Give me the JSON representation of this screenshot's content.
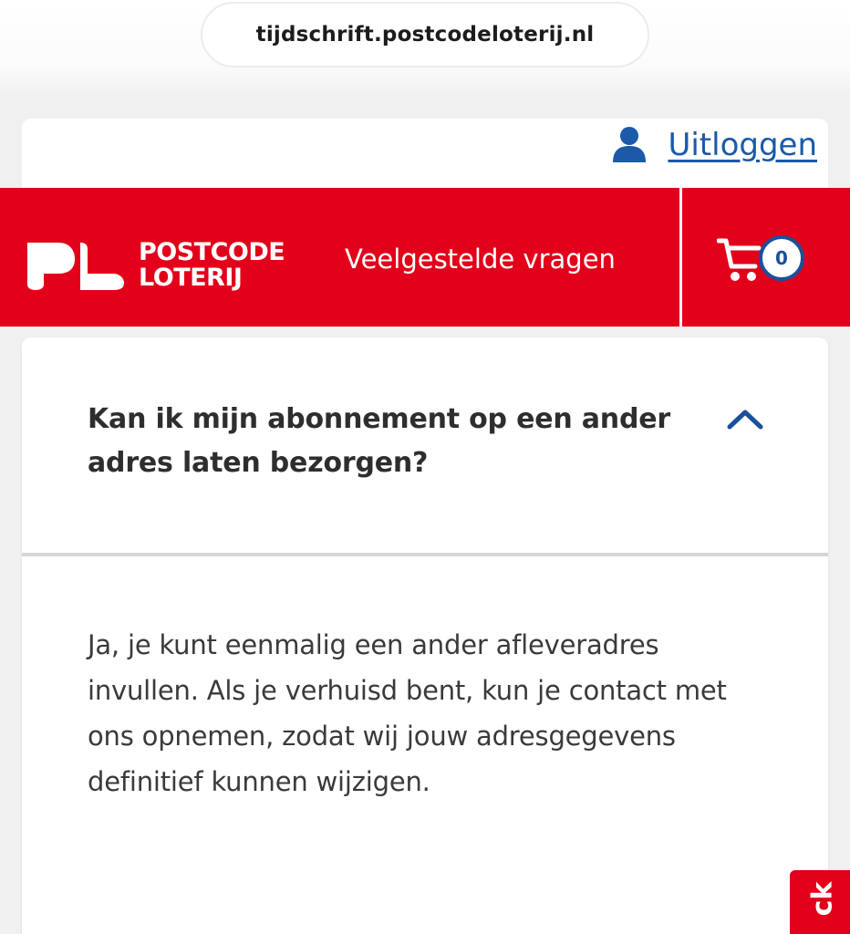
{
  "browser": {
    "url": "tijdschrift.postcodeloterij.nl"
  },
  "account": {
    "logout_label": "Uitloggen",
    "icon": "user-icon"
  },
  "header": {
    "logo_line1": "POSTCODE",
    "logo_line2": "LOTERIJ",
    "page_title": "Veelgestelde vragen",
    "cart_count": "0",
    "brand_color": "#e2001a",
    "accent_color": "#1b4f9c"
  },
  "faq": {
    "question": "Kan ik mijn abonnement op een ander adres laten bezorgen?",
    "answer": "Ja, je kunt eenmalig een ander afleveradres invullen. Als je verhuisd bent, kun je contact met ons opnemen, zodat wij jouw adresgegevens definitief kunnen wijzigen.",
    "expanded": true
  },
  "feedback_tab": {
    "label": "ck"
  }
}
